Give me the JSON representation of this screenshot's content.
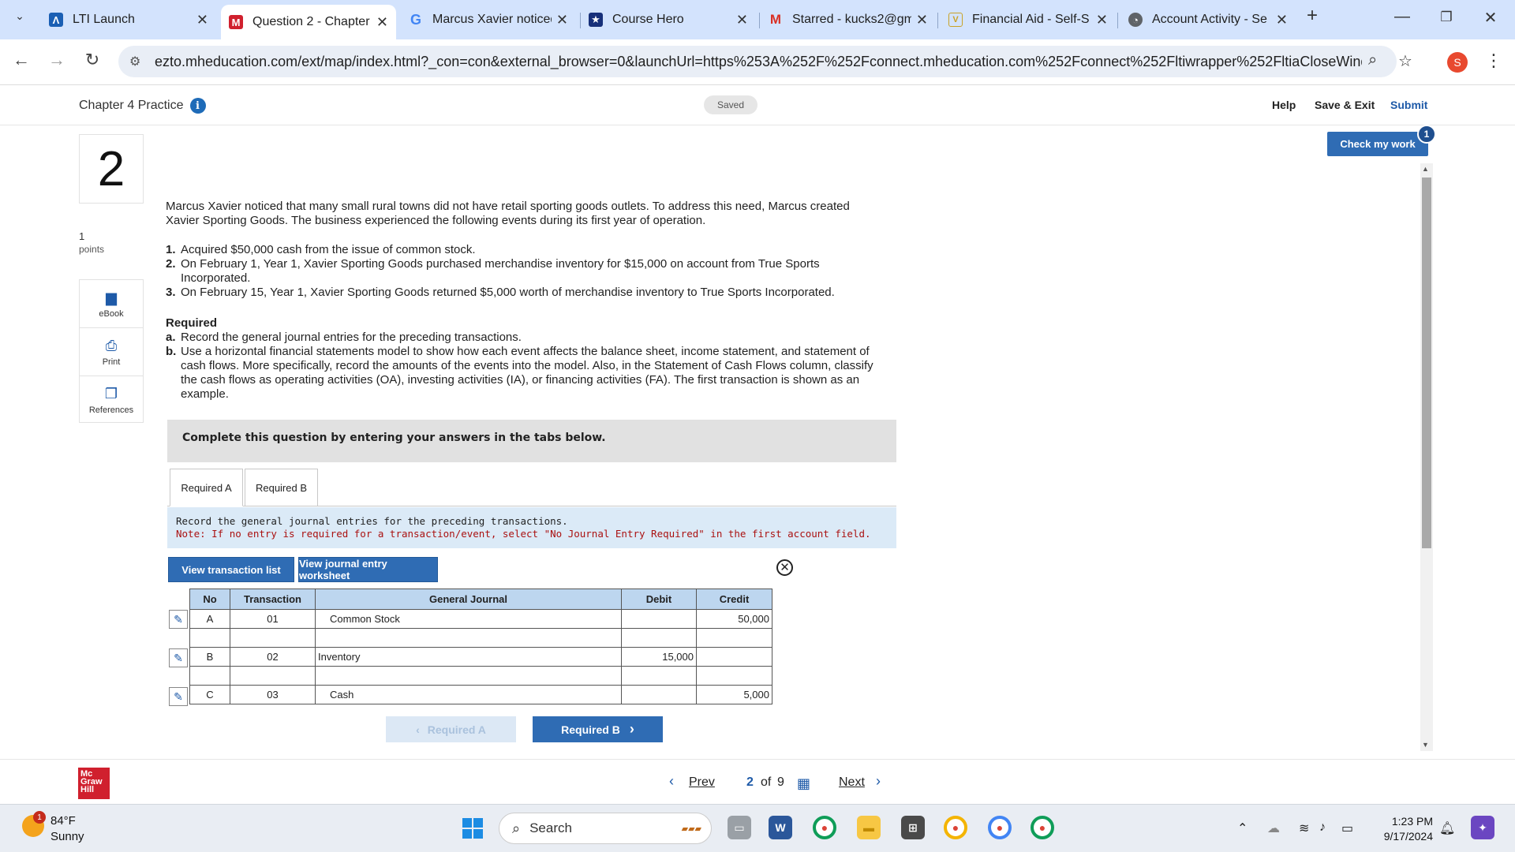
{
  "browser": {
    "tabs": [
      {
        "title": "LTI Launch",
        "icon": "lti-icon"
      },
      {
        "title": "Question 2 - Chapter",
        "icon": "mcgraw-icon"
      },
      {
        "title": "Marcus Xavier noticed",
        "icon": "google-icon"
      },
      {
        "title": "Course Hero",
        "icon": "coursehero-icon"
      },
      {
        "title": "Starred - kucks2@gm",
        "icon": "gmail-icon"
      },
      {
        "title": "Financial Aid - Self-S",
        "icon": "finaid-icon"
      },
      {
        "title": "Account Activity - Se",
        "icon": "account-icon"
      }
    ],
    "url": "ezto.mheducation.com/ext/map/index.html?_con=con&external_browser=0&launchUrl=https%253A%252F%252Fconnect.mheducation.com%252Fconnect%252Fltiwrapper%252FltiaCloseWindow....",
    "profile_initial": "S"
  },
  "header": {
    "chapter_title": "Chapter 4 Practice",
    "saved_label": "Saved",
    "help_label": "Help",
    "save_exit_label": "Save & Exit",
    "submit_label": "Submit",
    "check_label": "Check my work",
    "check_badge": "1"
  },
  "question": {
    "number": "2",
    "points_value": "1",
    "points_label": "points",
    "rail": {
      "ebook": "eBook",
      "print": "Print",
      "references": "References"
    },
    "intro_line1": "Marcus Xavier noticed that many small rural towns did not have retail sporting goods outlets. To address this need, Marcus created",
    "intro_line2": "Xavier Sporting Goods. The business experienced the following events during its first year of operation.",
    "events": [
      {
        "num": "1.",
        "text1": "Acquired $50,000 cash from the issue of common stock.",
        "text2": ""
      },
      {
        "num": "2.",
        "text1": "On February 1, Year 1, Xavier Sporting Goods purchased merchandise inventory for $15,000 on account from True Sports",
        "text2": "Incorporated."
      },
      {
        "num": "3.",
        "text1": "On February 15, Year 1, Xavier Sporting Goods returned $5,000 worth of merchandise inventory to True Sports Incorporated.",
        "text2": ""
      }
    ],
    "required_heading": "Required",
    "req_a": {
      "num": "a.",
      "text": "Record the general journal entries for the preceding transactions."
    },
    "req_b": {
      "num": "b.",
      "line1": "Use a horizontal financial statements model to show how each event affects the balance sheet, income statement, and statement of",
      "line2": "cash flows. More specifically, record the amounts of the events into the model. Also, in the Statement of Cash Flows column, classify",
      "line3": "the cash flows as operating activities (OA), investing activities (IA), or financing activities (FA). The first transaction is shown as an",
      "line4": "example."
    }
  },
  "workspace": {
    "complete_text": "Complete this question by entering your answers in the tabs below.",
    "tab_a": "Required A",
    "tab_b": "Required B",
    "note_line1": "Record the general journal entries for the preceding transactions.",
    "note_line2": "Note: If no entry is required for a transaction/event, select \"No Journal Entry Required\" in the first account field.",
    "btn_transactions": "View transaction list",
    "btn_worksheet": "View journal entry worksheet",
    "table": {
      "headers": [
        "No",
        "Transaction",
        "General Journal",
        "Debit",
        "Credit"
      ],
      "rows": [
        {
          "no": "A",
          "trans": "01",
          "account": "Common Stock",
          "debit": "",
          "credit": "50,000"
        },
        {
          "no": "",
          "trans": "",
          "account": "",
          "debit": "",
          "credit": ""
        },
        {
          "no": "B",
          "trans": "02",
          "account": "Inventory",
          "debit": "15,000",
          "credit": ""
        },
        {
          "no": "",
          "trans": "",
          "account": "",
          "debit": "",
          "credit": ""
        },
        {
          "no": "C",
          "trans": "03",
          "account": "Cash",
          "debit": "",
          "credit": "5,000"
        }
      ]
    },
    "prev_tab_btn": "Required A",
    "next_tab_btn": "Required B"
  },
  "footer": {
    "logo_lines": [
      "Mc",
      "Graw",
      "Hill"
    ],
    "prev_label": "Prev",
    "page_current": "2",
    "page_of": "of",
    "page_total": "9",
    "next_label": "Next"
  },
  "taskbar": {
    "temperature": "84°F",
    "condition": "Sunny",
    "weather_badge": "1",
    "search_label": "Search",
    "time": "1:23 PM",
    "date": "9/17/2024"
  }
}
